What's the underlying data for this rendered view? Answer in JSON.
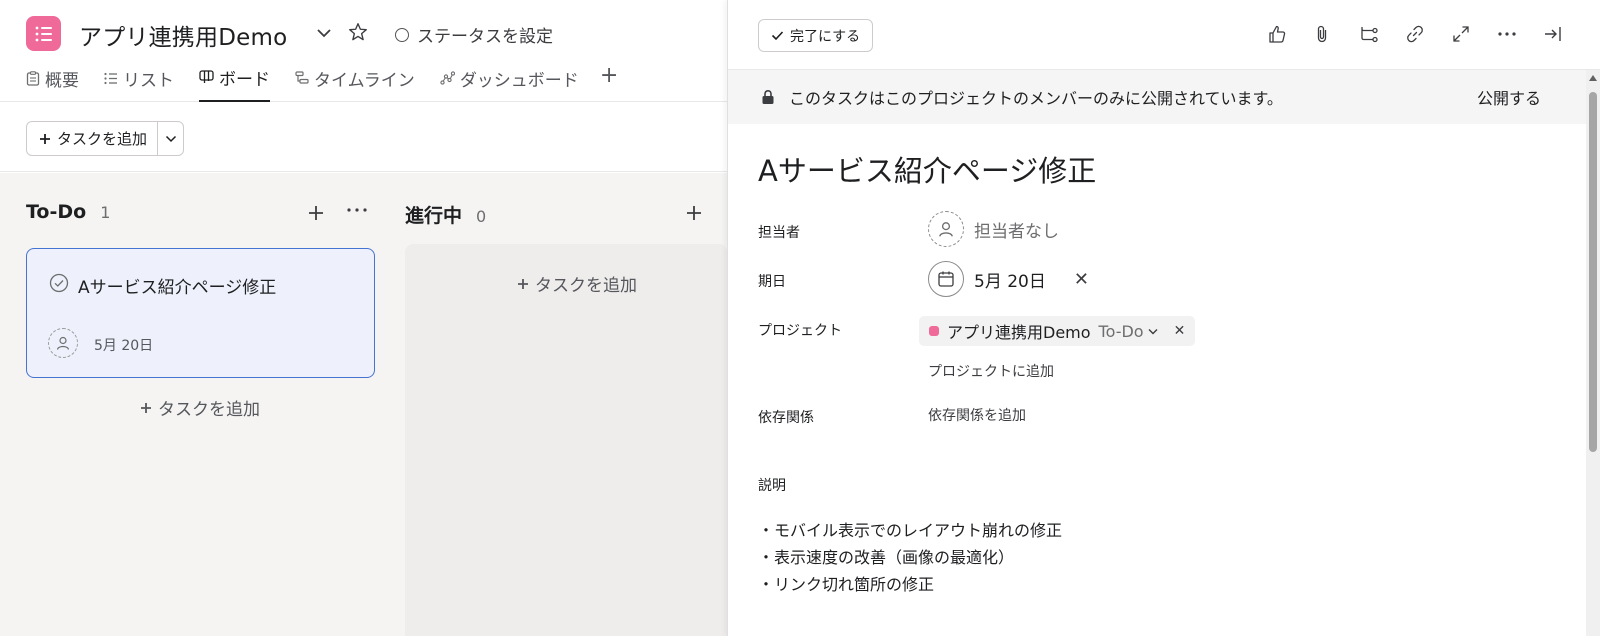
{
  "project": {
    "title": "アプリ連携用Demo",
    "status_label": "ステータスを設定",
    "icon_color": "#f06a99",
    "tabs": [
      {
        "label": "概要",
        "icon": "overview-icon"
      },
      {
        "label": "リスト",
        "icon": "list-icon"
      },
      {
        "label": "ボード",
        "icon": "board-icon",
        "active": true
      },
      {
        "label": "タイムライン",
        "icon": "timeline-icon"
      },
      {
        "label": "ダッシュボード",
        "icon": "dashboard-icon"
      }
    ],
    "add_tab": "+"
  },
  "toolbar": {
    "add_task_label": "タスクを追加"
  },
  "board": {
    "columns": [
      {
        "name": "To-Do",
        "count": "1",
        "add_label": "タスクを追加"
      },
      {
        "name": "進行中",
        "count": "0",
        "add_label": "タスクを追加"
      }
    ],
    "card": {
      "title": "Aサービス紹介ページ修正",
      "due": "5月 20日"
    }
  },
  "panel": {
    "complete_label": "完了にする",
    "notice": "このタスクはこのプロジェクトのメンバーのみに公開されています。",
    "publish_label": "公開する",
    "task_title": "Aサービス紹介ページ修正",
    "fields": {
      "assignee_label": "担当者",
      "assignee_value": "担当者なし",
      "due_label": "期日",
      "due_value": "5月 20日",
      "project_label": "プロジェクト",
      "project_name": "アプリ連携用Demo",
      "project_section": "To-Do",
      "add_project": "プロジェクトに追加",
      "dependency_label": "依存関係",
      "add_dependency": "依存関係を追加"
    },
    "description_label": "説明",
    "description_lines": [
      "・モバイル表示でのレイアウト崩れの修正",
      "・表示速度の改善（画像の最適化）",
      "・リンク切れ箇所の修正"
    ]
  }
}
